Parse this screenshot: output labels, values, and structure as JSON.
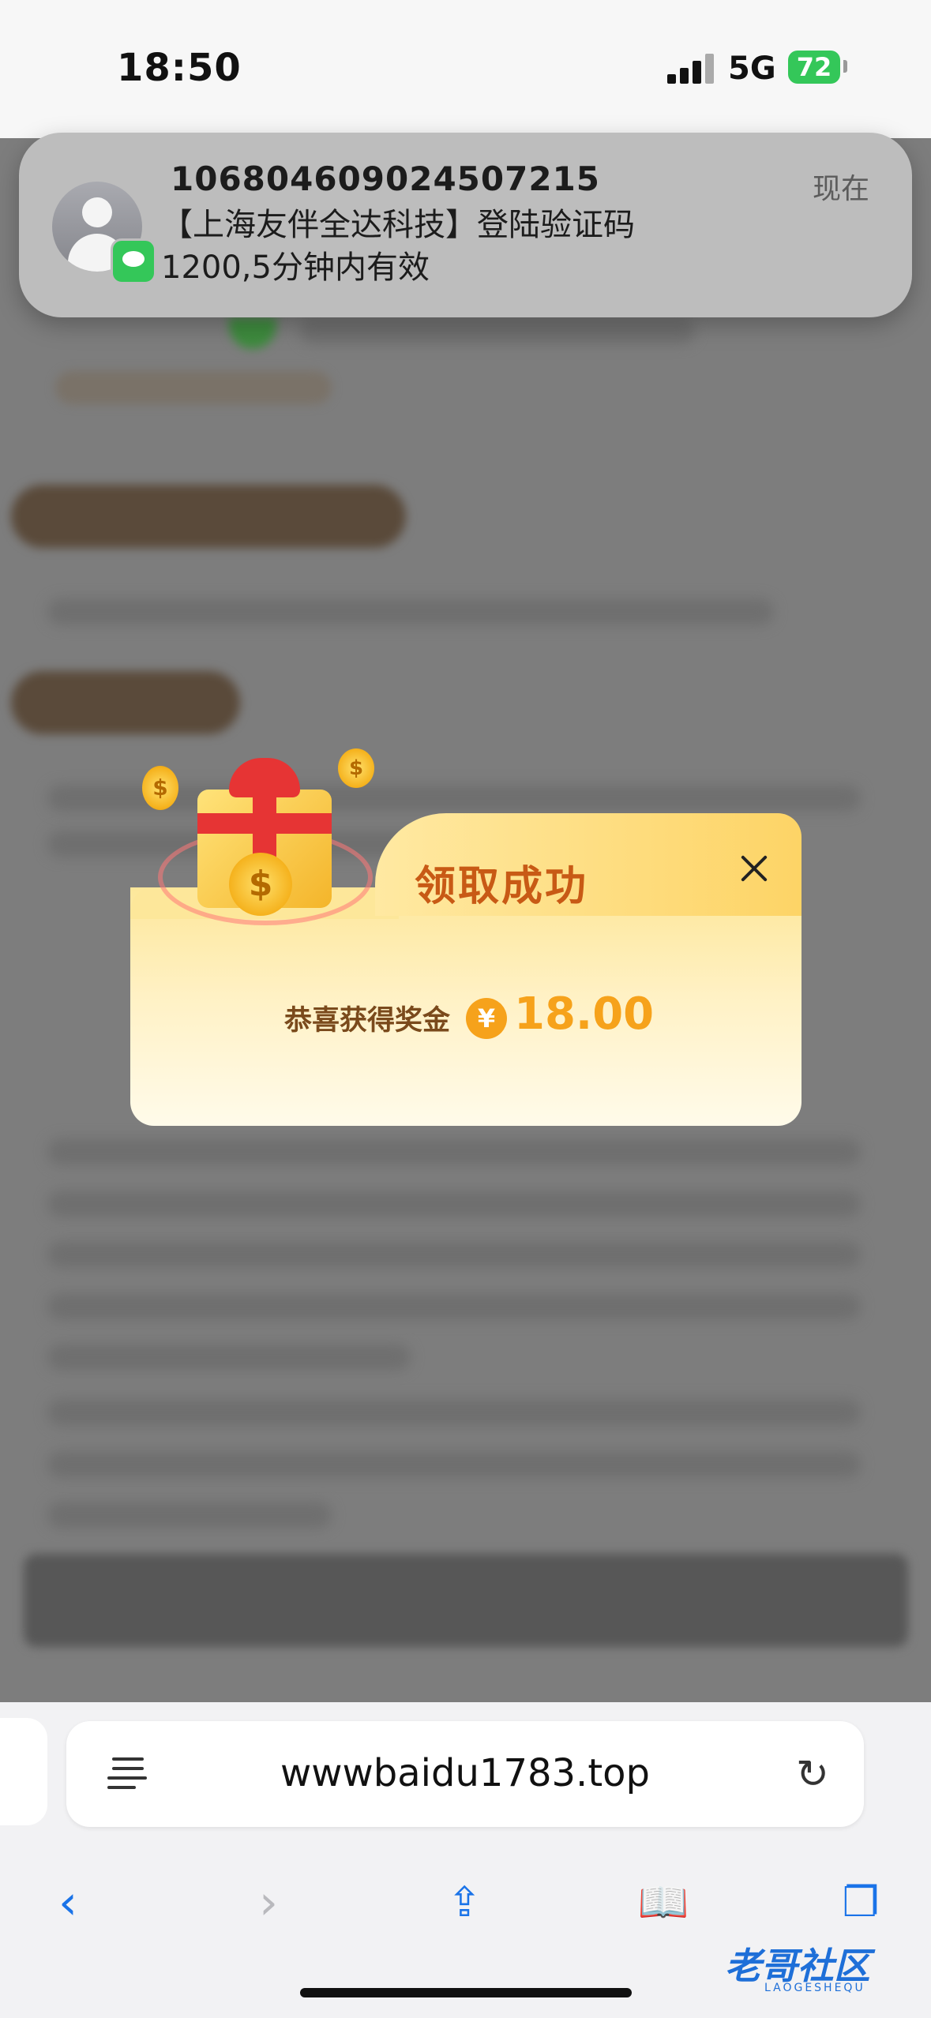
{
  "status": {
    "time": "18:50",
    "network": "5G",
    "battery": "72"
  },
  "notification": {
    "sender": "106804609024507215",
    "time": "现在",
    "body": "【上海友伴全达科技】登陆验证码\n 1200,5分钟内有效"
  },
  "modal": {
    "title": "领取成功",
    "prize_label": "恭喜获得奖金",
    "currency": "¥",
    "amount": "18.00"
  },
  "browser": {
    "url": "wwwbaidu1783.top",
    "toolbar": [
      "back-icon",
      "forward-icon",
      "share-icon",
      "bookmarks-icon",
      "tabs-icon"
    ]
  },
  "watermark": {
    "main": "老哥社区",
    "sub": "LAOGESHEQU"
  }
}
